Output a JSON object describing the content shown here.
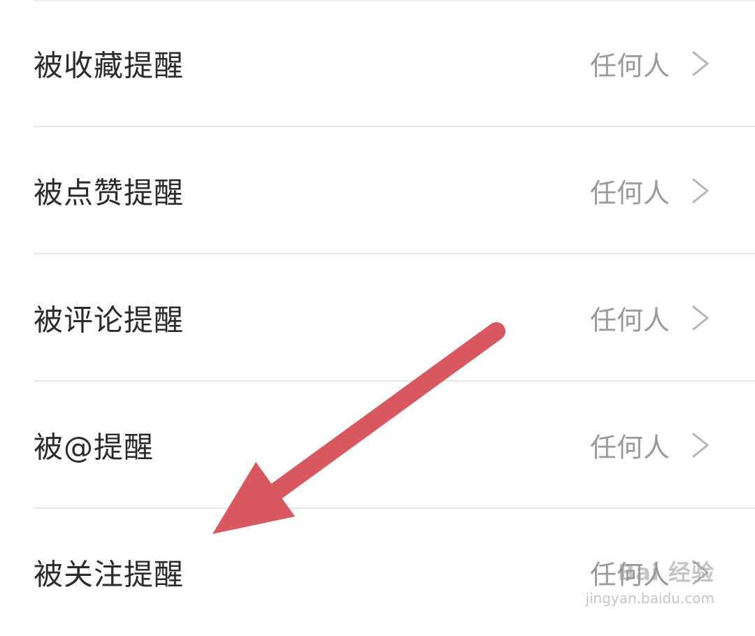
{
  "settings": {
    "rows": [
      {
        "label": "被收藏提醒",
        "value": "任何人"
      },
      {
        "label": "被点赞提醒",
        "value": "任何人"
      },
      {
        "label": "被评论提醒",
        "value": "任何人"
      },
      {
        "label": "被@提醒",
        "value": "任何人"
      },
      {
        "label": "被关注提醒",
        "value": "任何人"
      }
    ]
  },
  "annotation": {
    "arrow_color": "#D9575E"
  },
  "watermark": {
    "brand": "Bai 经验",
    "url": "jingyan.baidu.com"
  }
}
